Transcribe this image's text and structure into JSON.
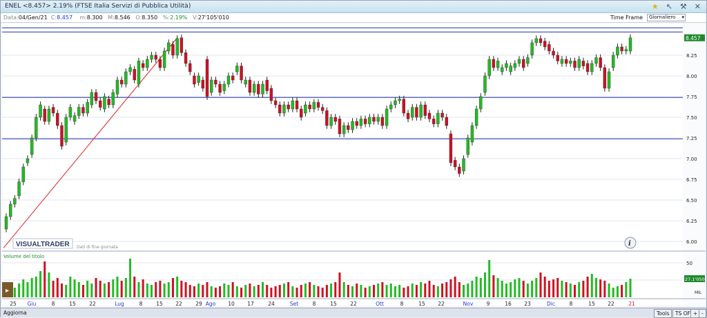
{
  "titlebar": {
    "title": "ENEL <8.457> 2.19%  (FTSE Italia Servizi di Pubblica Utilità)"
  },
  "quote": {
    "data_label": "Data:",
    "data": "04/Gen/21",
    "c_label": "C:",
    "c": "8.457",
    "m_label": "m:",
    "m": "8.300",
    "M_label": "M:",
    "M": "8.546",
    "o_label": "O:",
    "o": "8.350",
    "pct_label": "%:",
    "pct": "2.19%",
    "v_label": "V:",
    "v": "27'105'010"
  },
  "timeframe": {
    "label": "Time Frame",
    "value": "Giornaliero"
  },
  "watermark": {
    "brand": "VISUALTRADER",
    "sub": "Dati di fine giornata"
  },
  "volume_label": "Volume del titolo",
  "statusbar": {
    "aggiorna": "Aggiorna",
    "tools": "Tools",
    "tsoff": "TS OFF"
  },
  "colors": {
    "up": "#22bb22",
    "down": "#cc1122",
    "hline": "#2233aa",
    "trend": "#e02020"
  },
  "chart_data": {
    "type": "candlestick",
    "title": "ENEL",
    "ylim": [
      5.85,
      8.6
    ],
    "y_ticks": [
      6.0,
      6.25,
      6.5,
      6.75,
      7.0,
      7.25,
      7.5,
      7.75,
      8.0,
      8.25
    ],
    "y_tick_labels": [
      "6.00",
      "6.25",
      "6.50",
      "6.75",
      "7.00",
      "7.25",
      "7.50",
      "7.75",
      "8.00",
      "8.25"
    ],
    "last_price_label": "8.457",
    "x_labels": [
      "25",
      "Giu",
      "8",
      "15",
      "22",
      "Lug",
      "8",
      "15",
      "22",
      "29",
      "Ago",
      "10",
      "17",
      "24",
      "Set",
      "8",
      "15",
      "22",
      "Ott",
      "8",
      "15",
      "22",
      "Nov",
      "9",
      "16",
      "23",
      "Dic",
      "8",
      "15",
      "22",
      "21"
    ],
    "x_label_blue": [
      "Giu",
      "Lug",
      "Ago",
      "Set",
      "Ott",
      "Nov",
      "Dic"
    ],
    "x_label_red": [
      "21"
    ],
    "horizontal_lines": [
      8.58,
      8.53,
      7.74,
      7.24
    ],
    "trendline": {
      "from": [
        0,
        5.92
      ],
      "to": [
        40,
        8.46
      ]
    },
    "candles": [
      [
        6.15,
        6.3
      ],
      [
        6.3,
        6.45
      ],
      [
        6.45,
        6.52
      ],
      [
        6.55,
        6.72
      ],
      [
        6.72,
        6.9
      ],
      [
        6.95,
        7.0
      ],
      [
        7.05,
        7.25
      ],
      [
        7.25,
        7.5
      ],
      [
        7.5,
        7.65
      ],
      [
        7.6,
        7.45
      ],
      [
        7.45,
        7.6
      ],
      [
        7.62,
        7.55
      ],
      [
        7.55,
        7.4
      ],
      [
        7.4,
        7.15
      ],
      [
        7.2,
        7.5
      ],
      [
        7.5,
        7.62
      ],
      [
        7.45,
        7.52
      ],
      [
        7.52,
        7.62
      ],
      [
        7.62,
        7.55
      ],
      [
        7.55,
        7.68
      ],
      [
        7.65,
        7.8
      ],
      [
        7.8,
        7.7
      ],
      [
        7.7,
        7.62
      ],
      [
        7.6,
        7.75
      ],
      [
        7.72,
        7.65
      ],
      [
        7.65,
        7.8
      ],
      [
        7.78,
        7.95
      ],
      [
        7.95,
        7.9
      ],
      [
        7.9,
        8.05
      ],
      [
        8.05,
        8.1
      ],
      [
        8.08,
        7.95
      ],
      [
        7.9,
        8.18
      ],
      [
        8.15,
        8.1
      ],
      [
        8.1,
        8.2
      ],
      [
        8.2,
        8.25
      ],
      [
        8.25,
        8.2
      ],
      [
        8.2,
        8.1
      ],
      [
        8.1,
        8.3
      ],
      [
        8.3,
        8.4
      ],
      [
        8.38,
        8.25
      ],
      [
        8.25,
        8.45
      ],
      [
        8.46,
        8.28
      ],
      [
        8.28,
        8.15
      ],
      [
        8.15,
        8.05
      ],
      [
        8.0,
        7.9
      ],
      [
        7.92,
        8.0
      ],
      [
        7.95,
        7.85
      ],
      [
        8.2,
        7.75
      ],
      [
        7.8,
        7.95
      ],
      [
        7.95,
        7.9
      ],
      [
        7.9,
        7.8
      ],
      [
        7.82,
        7.9
      ],
      [
        7.9,
        8.0
      ],
      [
        8.0,
        7.95
      ],
      [
        8.05,
        8.12
      ],
      [
        8.12,
        7.95
      ],
      [
        7.9,
        7.95
      ],
      [
        7.95,
        7.8
      ],
      [
        7.8,
        7.9
      ],
      [
        7.9,
        7.78
      ],
      [
        7.78,
        7.9
      ],
      [
        7.95,
        7.82
      ],
      [
        7.85,
        7.7
      ],
      [
        7.7,
        7.65
      ],
      [
        7.65,
        7.55
      ],
      [
        7.55,
        7.65
      ],
      [
        7.65,
        7.6
      ],
      [
        7.6,
        7.7
      ],
      [
        7.7,
        7.6
      ],
      [
        7.6,
        7.5
      ],
      [
        7.55,
        7.65
      ],
      [
        7.65,
        7.6
      ],
      [
        7.6,
        7.68
      ],
      [
        7.68,
        7.62
      ],
      [
        7.62,
        7.58
      ],
      [
        7.58,
        7.4
      ],
      [
        7.4,
        7.5
      ],
      [
        7.5,
        7.45
      ],
      [
        7.48,
        7.3
      ],
      [
        7.3,
        7.4
      ],
      [
        7.4,
        7.35
      ],
      [
        7.35,
        7.45
      ],
      [
        7.45,
        7.4
      ],
      [
        7.4,
        7.48
      ],
      [
        7.48,
        7.42
      ],
      [
        7.42,
        7.5
      ],
      [
        7.5,
        7.45
      ],
      [
        7.45,
        7.5
      ],
      [
        7.5,
        7.4
      ],
      [
        7.4,
        7.6
      ],
      [
        7.6,
        7.65
      ],
      [
        7.65,
        7.7
      ],
      [
        7.7,
        7.72
      ],
      [
        7.72,
        7.55
      ],
      [
        7.55,
        7.48
      ],
      [
        7.5,
        7.62
      ],
      [
        7.62,
        7.5
      ],
      [
        7.5,
        7.65
      ],
      [
        7.65,
        7.52
      ],
      [
        7.55,
        7.48
      ],
      [
        7.48,
        7.42
      ],
      [
        7.42,
        7.55
      ],
      [
        7.55,
        7.5
      ],
      [
        7.5,
        7.4
      ],
      [
        7.3,
        6.95
      ],
      [
        6.98,
        6.9
      ],
      [
        6.9,
        6.82
      ],
      [
        6.85,
        7.0
      ],
      [
        7.05,
        7.25
      ],
      [
        7.2,
        7.4
      ],
      [
        7.4,
        7.6
      ],
      [
        7.6,
        7.75
      ],
      [
        7.8,
        8.0
      ],
      [
        8.0,
        8.2
      ],
      [
        8.2,
        8.1
      ],
      [
        8.1,
        8.18
      ],
      [
        8.05,
        8.1
      ],
      [
        8.1,
        8.15
      ],
      [
        8.05,
        8.12
      ],
      [
        8.1,
        8.15
      ],
      [
        8.15,
        8.2
      ],
      [
        8.2,
        8.1
      ],
      [
        8.15,
        8.22
      ],
      [
        8.25,
        8.4
      ],
      [
        8.4,
        8.45
      ],
      [
        8.45,
        8.4
      ],
      [
        8.42,
        8.35
      ],
      [
        8.38,
        8.3
      ],
      [
        8.3,
        8.25
      ],
      [
        8.25,
        8.18
      ],
      [
        8.15,
        8.2
      ],
      [
        8.2,
        8.15
      ],
      [
        8.15,
        8.18
      ],
      [
        8.18,
        8.1
      ],
      [
        8.1,
        8.2
      ],
      [
        8.18,
        8.12
      ],
      [
        8.15,
        8.05
      ],
      [
        8.05,
        8.15
      ],
      [
        8.15,
        8.22
      ],
      [
        8.22,
        8.1
      ],
      [
        8.1,
        7.85
      ],
      [
        7.85,
        8.05
      ],
      [
        8.1,
        8.25
      ],
      [
        8.25,
        8.35
      ],
      [
        8.35,
        8.3
      ],
      [
        8.3,
        8.32
      ],
      [
        8.3,
        8.46
      ]
    ],
    "volume": {
      "label": "Volume del titolo",
      "unit_label": "MIL",
      "ticks": [
        25,
        50
      ],
      "last_label": "27.1'050",
      "ylim": [
        0,
        60
      ],
      "values": [
        8,
        12,
        14,
        20,
        26,
        22,
        28,
        30,
        38,
        52,
        36,
        24,
        28,
        20,
        18,
        30,
        26,
        22,
        18,
        24,
        20,
        28,
        24,
        20,
        22,
        26,
        30,
        24,
        28,
        56,
        30,
        22,
        26,
        20,
        18,
        22,
        24,
        20,
        22,
        28,
        30,
        24,
        22,
        18,
        16,
        20,
        18,
        22,
        16,
        14,
        16,
        20,
        18,
        22,
        16,
        14,
        18,
        20,
        16,
        18,
        22,
        18,
        14,
        16,
        18,
        20,
        22,
        16,
        14,
        18,
        20,
        22,
        18,
        16,
        14,
        18,
        20,
        22,
        36,
        22,
        18,
        16,
        20,
        18,
        14,
        16,
        18,
        20,
        22,
        18,
        20,
        16,
        18,
        14,
        16,
        20,
        18,
        22,
        20,
        24,
        18,
        16,
        20,
        22,
        26,
        30,
        22,
        18,
        20,
        24,
        30,
        28,
        36,
        54,
        32,
        28,
        24,
        20,
        22,
        26,
        28,
        24,
        20,
        24,
        28,
        36,
        30,
        24,
        26,
        28,
        24,
        22,
        20,
        18,
        22,
        24,
        30,
        34,
        28,
        26,
        24,
        20,
        14,
        16,
        18,
        22,
        27
      ]
    }
  }
}
